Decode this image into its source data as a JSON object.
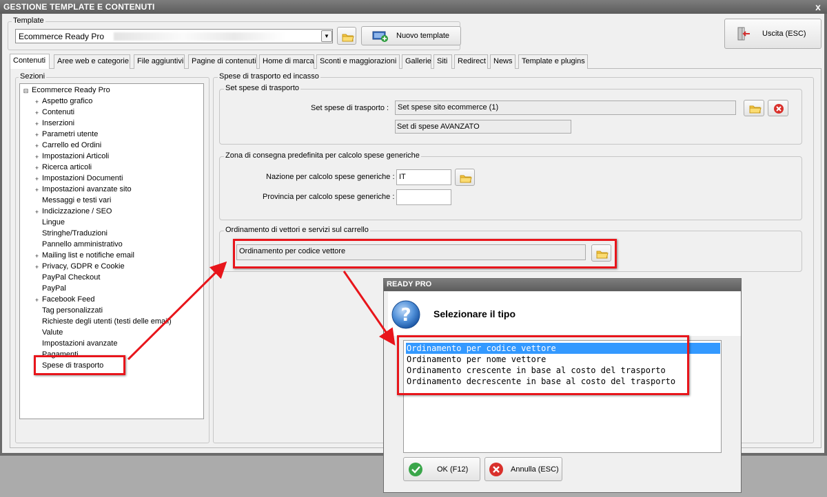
{
  "window": {
    "title": "GESTIONE TEMPLATE E CONTENUTI",
    "close_glyph": "x"
  },
  "template": {
    "label": "Template",
    "value": "Ecommerce Ready Pro",
    "new_button": "Nuovo template",
    "exit_button": "Uscita (ESC)"
  },
  "tabs": [
    {
      "label": "Contenuti",
      "active": true
    },
    {
      "label": "Aree web e categorie"
    },
    {
      "label": "File aggiuntivi"
    },
    {
      "label": "Pagine di contenuti"
    },
    {
      "label": "Home di marca"
    },
    {
      "label": "Sconti e maggiorazioni"
    },
    {
      "label": "Gallerie"
    },
    {
      "label": "Siti"
    },
    {
      "label": "Redirect"
    },
    {
      "label": "News"
    },
    {
      "label": "Template e plugins"
    }
  ],
  "sezioni": {
    "label": "Sezioni",
    "root": "Ecommerce Ready Pro",
    "items": [
      {
        "label": "Aspetto grafico",
        "expandable": true
      },
      {
        "label": "Contenuti",
        "expandable": true
      },
      {
        "label": "Inserzioni",
        "expandable": true
      },
      {
        "label": "Parametri utente",
        "expandable": true
      },
      {
        "label": "Carrello ed Ordini",
        "expandable": true
      },
      {
        "label": "Impostazioni Articoli",
        "expandable": true
      },
      {
        "label": "Ricerca articoli",
        "expandable": true
      },
      {
        "label": "Impostazioni Documenti",
        "expandable": true
      },
      {
        "label": "Impostazioni avanzate sito",
        "expandable": true
      },
      {
        "label": "Messaggi e testi vari",
        "expandable": false
      },
      {
        "label": "Indicizzazione / SEO",
        "expandable": true
      },
      {
        "label": "Lingue",
        "expandable": false
      },
      {
        "label": "Stringhe/Traduzioni",
        "expandable": false
      },
      {
        "label": "Pannello amministrativo",
        "expandable": false
      },
      {
        "label": "Mailing list e notifiche email",
        "expandable": true
      },
      {
        "label": "Privacy, GDPR e Cookie",
        "expandable": true
      },
      {
        "label": "PayPal Checkout",
        "expandable": false
      },
      {
        "label": "PayPal",
        "expandable": false
      },
      {
        "label": "Facebook Feed",
        "expandable": true
      },
      {
        "label": "Tag personalizzati",
        "expandable": false
      },
      {
        "label": "Richieste degli utenti (testi delle email)",
        "expandable": false
      },
      {
        "label": "Valute",
        "expandable": false
      },
      {
        "label": "Impostazioni avanzate",
        "expandable": false
      },
      {
        "label": "Pagamenti",
        "expandable": false
      },
      {
        "label": "Spese di trasporto",
        "expandable": false,
        "selected": true
      }
    ]
  },
  "spese": {
    "title": "Spese di trasporto ed incasso",
    "set_group": {
      "label": "Set spese di trasporto",
      "caption": "Set spese di trasporto :",
      "value": "Set spese sito ecommerce (1)",
      "type": "Set di spese AVANZATO"
    },
    "zona_group": {
      "label": "Zona di consegna predefinita per calcolo spese generiche",
      "nazione_caption": "Nazione per calcolo spese generiche :",
      "nazione_value": "IT",
      "provincia_caption": "Provincia per calcolo spese generiche :",
      "provincia_value": ""
    },
    "ord_group": {
      "label": "Ordinamento di vettori e servizi sul carrello",
      "value": "Ordinamento per codice vettore"
    }
  },
  "dialog": {
    "title": "READY PRO",
    "question": "Selezionare il tipo",
    "options": [
      {
        "label": "Ordinamento per codice vettore",
        "selected": true
      },
      {
        "label": "Ordinamento per nome vettore"
      },
      {
        "label": "Ordinamento crescente in base al costo del trasporto"
      },
      {
        "label": "Ordinamento decrescente in base al costo del trasporto"
      }
    ],
    "ok": "OK (F12)",
    "cancel": "Annulla (ESC)"
  },
  "colors": {
    "highlight": "#e8151b",
    "selection": "#3399ff",
    "title_bar": "#6b6b6b"
  }
}
